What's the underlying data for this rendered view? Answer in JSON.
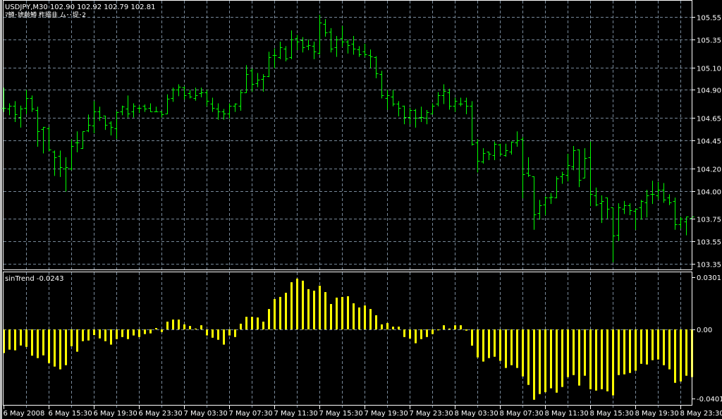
{
  "header": {
    "symbol_line": "USDJPY,M30  102.90 102.92 102.79 102.81",
    "subtitle_line": "ﾏ鱒･琥齢鱒 柞搦韭  ム･･堤･2"
  },
  "indicator": {
    "label": "sinTrend -0.0243"
  },
  "colors": {
    "background": "#000000",
    "bars": "#00ff00",
    "histogram": "#ffff00",
    "grid": "#778899",
    "text": "#ffffff"
  },
  "chart_data": [
    {
      "type": "ohlc",
      "title": "USDJPY,M30",
      "price_ticks": [
        "105.55",
        "105.35",
        "105.10",
        "104.90",
        "104.65",
        "104.45",
        "104.20",
        "104.00",
        "103.75",
        "103.55",
        "103.35"
      ],
      "ylim": [
        103.3,
        105.7
      ],
      "grid": true,
      "time_labels": [
        "6 May 2008",
        "6 May 15:30",
        "6 May 19:30",
        "6 May 23:30",
        "7 May 03:30",
        "7 May 07:30",
        "7 May 11:30",
        "7 May 15:30",
        "7 May 19:30",
        "7 May 23:30",
        "8 May 03:30",
        "8 May 07:30",
        "8 May 11:30",
        "8 May 15:30",
        "8 May 19:30",
        "8 May 23:30"
      ],
      "ohlc": [
        [
          104.74,
          104.92,
          104.71,
          104.74
        ],
        [
          104.73,
          104.78,
          104.68,
          104.76
        ],
        [
          104.76,
          104.8,
          104.62,
          104.68
        ],
        [
          104.66,
          104.76,
          104.57,
          104.73
        ],
        [
          104.74,
          104.9,
          104.69,
          104.83
        ],
        [
          104.83,
          104.85,
          104.71,
          104.73
        ],
        [
          104.72,
          104.75,
          104.4,
          104.53
        ],
        [
          104.55,
          104.57,
          104.34,
          104.57
        ],
        [
          104.56,
          104.57,
          104.36,
          104.37
        ],
        [
          104.35,
          104.36,
          104.14,
          104.3
        ],
        [
          104.31,
          104.36,
          104.13,
          104.21
        ],
        [
          104.2,
          104.3,
          104.0,
          104.21
        ],
        [
          104.2,
          104.46,
          104.19,
          104.4
        ],
        [
          104.43,
          104.53,
          104.35,
          104.43
        ],
        [
          104.38,
          104.53,
          104.38,
          104.53
        ],
        [
          104.54,
          104.68,
          104.53,
          104.59
        ],
        [
          104.58,
          104.8,
          104.52,
          104.71
        ],
        [
          104.71,
          104.75,
          104.63,
          104.66
        ],
        [
          104.67,
          104.67,
          104.55,
          104.59
        ],
        [
          104.61,
          104.62,
          104.5,
          104.57
        ],
        [
          104.56,
          104.71,
          104.47,
          104.7
        ],
        [
          104.71,
          104.76,
          104.68,
          104.75
        ],
        [
          104.73,
          104.85,
          104.66,
          104.69
        ],
        [
          104.71,
          104.78,
          104.66,
          104.76
        ],
        [
          104.74,
          104.76,
          104.7,
          104.74
        ],
        [
          104.76,
          104.77,
          104.71,
          104.73
        ],
        [
          104.74,
          104.78,
          104.71,
          104.71
        ],
        [
          104.71,
          104.75,
          104.71,
          104.71
        ],
        [
          104.71,
          104.71,
          104.66,
          104.68
        ],
        [
          104.69,
          104.86,
          104.69,
          104.82
        ],
        [
          104.83,
          104.92,
          104.8,
          104.9
        ],
        [
          104.9,
          104.95,
          104.85,
          104.93
        ],
        [
          104.92,
          104.93,
          104.82,
          104.85
        ],
        [
          104.87,
          104.9,
          104.83,
          104.84
        ],
        [
          104.83,
          104.92,
          104.81,
          104.85
        ],
        [
          104.87,
          104.92,
          104.84,
          104.88
        ],
        [
          104.88,
          104.9,
          104.76,
          104.8
        ],
        [
          104.78,
          104.83,
          104.71,
          104.74
        ],
        [
          104.73,
          104.78,
          104.64,
          104.71
        ],
        [
          104.71,
          104.73,
          104.64,
          104.69
        ],
        [
          104.69,
          104.78,
          104.65,
          104.76
        ],
        [
          104.76,
          104.78,
          104.71,
          104.78
        ],
        [
          104.76,
          104.9,
          104.72,
          104.88
        ],
        [
          104.88,
          105.12,
          104.88,
          105.04
        ],
        [
          105.07,
          105.09,
          104.89,
          104.95
        ],
        [
          104.96,
          105.05,
          104.93,
          104.99
        ],
        [
          105.0,
          105.04,
          104.89,
          105.02
        ],
        [
          105.02,
          105.24,
          105.02,
          105.19
        ],
        [
          105.21,
          105.27,
          105.1,
          105.21
        ],
        [
          105.19,
          105.33,
          105.18,
          105.28
        ],
        [
          105.27,
          105.29,
          105.16,
          105.18
        ],
        [
          105.19,
          105.43,
          105.18,
          105.35
        ],
        [
          105.36,
          105.39,
          105.26,
          105.33
        ],
        [
          105.34,
          105.37,
          105.24,
          105.28
        ],
        [
          105.29,
          105.35,
          105.26,
          105.3
        ],
        [
          105.29,
          105.33,
          105.18,
          105.24
        ],
        [
          105.23,
          105.57,
          105.22,
          105.5
        ],
        [
          105.49,
          105.53,
          105.38,
          105.41
        ],
        [
          105.42,
          105.45,
          105.24,
          105.27
        ],
        [
          105.28,
          105.38,
          105.2,
          105.35
        ],
        [
          105.36,
          105.47,
          105.29,
          105.33
        ],
        [
          105.33,
          105.35,
          105.23,
          105.3
        ],
        [
          105.31,
          105.38,
          105.22,
          105.27
        ],
        [
          105.26,
          105.29,
          105.2,
          105.22
        ],
        [
          105.24,
          105.31,
          105.2,
          105.22
        ],
        [
          105.21,
          105.26,
          105.1,
          105.2
        ],
        [
          105.19,
          105.2,
          105.01,
          105.05
        ],
        [
          105.04,
          105.07,
          104.83,
          104.85
        ],
        [
          104.83,
          104.9,
          104.73,
          104.85
        ],
        [
          104.84,
          104.9,
          104.76,
          104.78
        ],
        [
          104.78,
          104.8,
          104.67,
          104.74
        ],
        [
          104.76,
          104.76,
          104.6,
          104.66
        ],
        [
          104.66,
          104.74,
          104.6,
          104.72
        ],
        [
          104.72,
          104.73,
          104.57,
          104.65
        ],
        [
          104.66,
          104.75,
          104.62,
          104.66
        ],
        [
          104.65,
          104.72,
          104.6,
          104.7
        ],
        [
          104.69,
          104.78,
          104.69,
          104.76
        ],
        [
          104.78,
          104.88,
          104.76,
          104.85
        ],
        [
          104.85,
          104.95,
          104.78,
          104.89
        ],
        [
          104.88,
          104.91,
          104.73,
          104.76
        ],
        [
          104.76,
          104.83,
          104.71,
          104.8
        ],
        [
          104.78,
          104.83,
          104.76,
          104.78
        ],
        [
          104.8,
          104.83,
          104.69,
          104.76
        ],
        [
          104.76,
          104.8,
          104.41,
          104.42
        ],
        [
          104.43,
          104.46,
          104.17,
          104.27
        ],
        [
          104.26,
          104.38,
          104.25,
          104.34
        ],
        [
          104.35,
          104.35,
          104.28,
          104.33
        ],
        [
          104.32,
          104.44,
          104.28,
          104.42
        ],
        [
          104.41,
          104.42,
          104.32,
          104.33
        ],
        [
          104.32,
          104.42,
          104.31,
          104.36
        ],
        [
          104.35,
          104.44,
          104.33,
          104.44
        ],
        [
          104.43,
          104.53,
          104.4,
          104.45
        ],
        [
          104.46,
          104.48,
          103.94,
          104.15
        ],
        [
          104.16,
          104.3,
          104.13,
          104.14
        ],
        [
          104.13,
          104.13,
          103.66,
          103.79
        ],
        [
          103.8,
          103.92,
          103.75,
          103.87
        ],
        [
          103.88,
          103.95,
          103.79,
          103.94
        ],
        [
          103.94,
          103.98,
          103.89,
          103.95
        ],
        [
          103.94,
          104.13,
          103.94,
          104.11
        ],
        [
          104.13,
          104.17,
          104.07,
          104.15
        ],
        [
          104.14,
          104.33,
          104.09,
          104.23
        ],
        [
          104.22,
          104.4,
          104.19,
          104.36
        ],
        [
          104.37,
          104.37,
          104.04,
          104.1
        ],
        [
          104.12,
          104.38,
          104.12,
          104.29
        ],
        [
          104.3,
          104.44,
          103.87,
          103.97
        ],
        [
          103.96,
          104.03,
          103.87,
          103.88
        ],
        [
          103.89,
          103.96,
          103.72,
          103.91
        ],
        [
          103.94,
          103.94,
          103.76,
          103.84
        ],
        [
          103.85,
          103.85,
          103.37,
          103.6
        ],
        [
          103.61,
          103.89,
          103.56,
          103.85
        ],
        [
          103.84,
          103.91,
          103.8,
          103.87
        ],
        [
          103.87,
          103.89,
          103.79,
          103.83
        ],
        [
          103.82,
          103.84,
          103.66,
          103.84
        ],
        [
          103.85,
          103.92,
          103.75,
          103.91
        ],
        [
          103.9,
          104.01,
          103.77,
          103.96
        ],
        [
          103.97,
          104.09,
          103.89,
          103.97
        ],
        [
          103.96,
          104.08,
          103.93,
          104.01
        ],
        [
          104.01,
          104.07,
          103.9,
          103.92
        ],
        [
          103.94,
          103.97,
          103.88,
          103.9
        ],
        [
          103.91,
          103.94,
          103.66,
          103.7
        ],
        [
          103.7,
          103.77,
          103.67,
          103.75
        ],
        [
          103.73,
          103.77,
          103.61,
          103.77
        ],
        [
          103.76,
          103.78,
          103.74,
          103.77
        ]
      ]
    },
    {
      "type": "bar",
      "title": "sinTrend -0.0243",
      "y_ticks": [
        "0.0301",
        "0.00",
        "-0.0401"
      ],
      "ylim": [
        -0.0401,
        0.0301
      ],
      "values": [
        -0.0137,
        -0.0117,
        -0.0121,
        -0.0093,
        -0.0101,
        -0.0152,
        -0.0166,
        -0.015,
        -0.0195,
        -0.0215,
        -0.0231,
        -0.0207,
        -0.0097,
        -0.0129,
        -0.0068,
        -0.0064,
        -0.0033,
        -0.0052,
        -0.0068,
        -0.0088,
        -0.0056,
        -0.0044,
        -0.0056,
        -0.0035,
        -0.0044,
        -0.0027,
        -0.0023,
        0.0008,
        -0.0015,
        0.0045,
        0.0057,
        0.0057,
        0.0029,
        0.002,
        0.0005,
        0.0024,
        -0.0035,
        -0.0048,
        -0.006,
        -0.0088,
        -0.0035,
        -0.0044,
        0.0033,
        0.0073,
        0.0073,
        0.0069,
        0.0045,
        0.0118,
        0.0176,
        0.0188,
        0.0212,
        0.0273,
        0.0294,
        0.0282,
        0.0233,
        0.0224,
        0.0253,
        0.0216,
        0.0147,
        0.0184,
        0.0188,
        0.0192,
        0.0151,
        0.0127,
        0.0139,
        0.0118,
        0.0082,
        0.0029,
        0.0037,
        0.0016,
        0.0016,
        -0.0044,
        -0.0053,
        -0.008,
        -0.0056,
        -0.0044,
        -0.0027,
        -0.0005,
        0.0024,
        0.0005,
        0.0024,
        0.0024,
        -0.0007,
        -0.0094,
        -0.0162,
        -0.0186,
        -0.0166,
        -0.0158,
        -0.0182,
        -0.0223,
        -0.0207,
        -0.0223,
        -0.0272,
        -0.0321,
        -0.0407,
        -0.0374,
        -0.0363,
        -0.0341,
        -0.0366,
        -0.0333,
        -0.0276,
        -0.0264,
        -0.0325,
        -0.0268,
        -0.0346,
        -0.0354,
        -0.0346,
        -0.0358,
        -0.0382,
        -0.0264,
        -0.026,
        -0.0252,
        -0.0239,
        -0.0199,
        -0.0203,
        -0.0178,
        -0.0174,
        -0.0207,
        -0.0231,
        -0.0309,
        -0.0301,
        -0.0268,
        -0.0276
      ]
    }
  ]
}
